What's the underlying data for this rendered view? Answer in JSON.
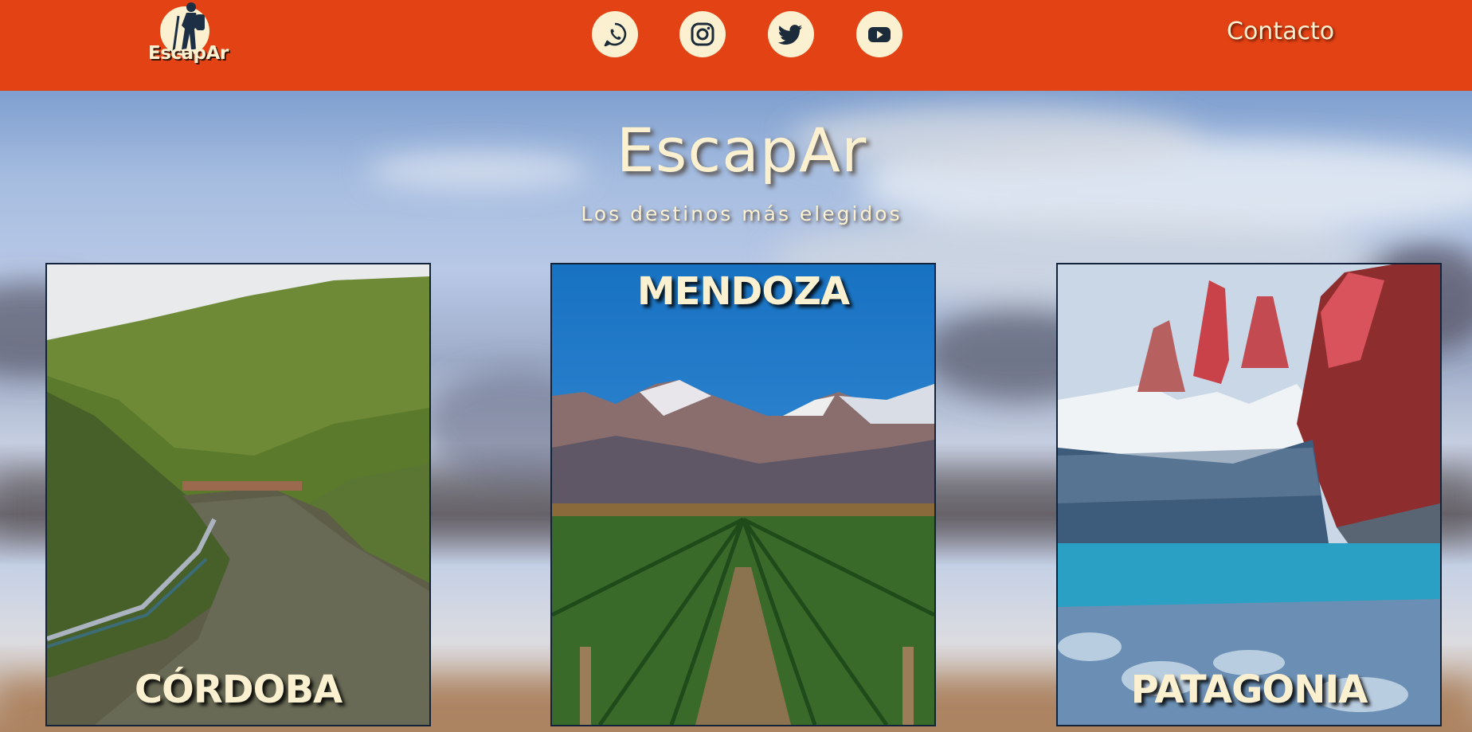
{
  "header": {
    "logo_text": "EscapAr",
    "social": [
      {
        "name": "whatsapp",
        "icon": "whatsapp-icon"
      },
      {
        "name": "instagram",
        "icon": "instagram-icon"
      },
      {
        "name": "twitter",
        "icon": "twitter-icon"
      },
      {
        "name": "youtube",
        "icon": "youtube-icon"
      }
    ],
    "contact_label": "Contacto"
  },
  "hero": {
    "title": "EscapAr",
    "subtitle": "Los destinos más elegidos"
  },
  "destinations": [
    {
      "name": "CÓRDOBA",
      "label_position": "bottom"
    },
    {
      "name": "MENDOZA",
      "label_position": "top"
    },
    {
      "name": "PATAGONIA",
      "label_position": "bottom"
    }
  ],
  "colors": {
    "header_bg": "#e34214",
    "cream": "#fbf0d0",
    "icon_dark": "#1b2b3a"
  }
}
